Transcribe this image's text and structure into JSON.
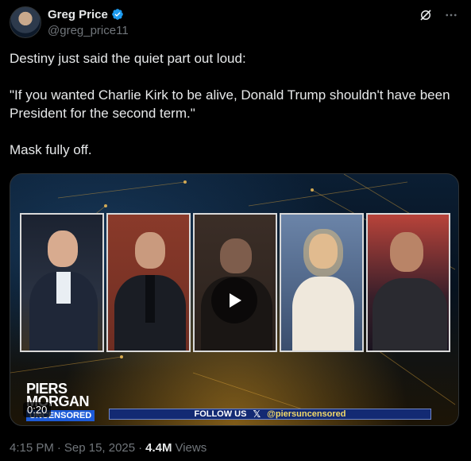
{
  "author": {
    "display_name": "Greg Price",
    "handle": "@greg_price11",
    "verified": true
  },
  "tweet": {
    "lines": [
      "Destiny just said the quiet part out loud:",
      "\"If you wanted Charlie Kirk to be alive, Donald Trump shouldn't have been President for the second term.\"",
      "Mask fully off."
    ]
  },
  "media": {
    "duration": "0:20",
    "logo_line1": "PIERS",
    "logo_line2": "MORGAN",
    "logo_sub": "UNCENSORED",
    "follow_label": "FOLLOW US",
    "follow_x": "𝕏",
    "follow_handle": "@piersuncensored"
  },
  "meta": {
    "time": "4:15 PM",
    "date": "Sep 15, 2025",
    "separator": "·",
    "views_count": "4.4M",
    "views_label": "Views"
  },
  "icons": [
    "grok-icon",
    "more-icon",
    "verified-badge-icon",
    "play-icon"
  ],
  "colors": {
    "accent": "#1d9bf0",
    "muted": "#71767b",
    "text": "#e7e9ea",
    "background": "#000000"
  }
}
